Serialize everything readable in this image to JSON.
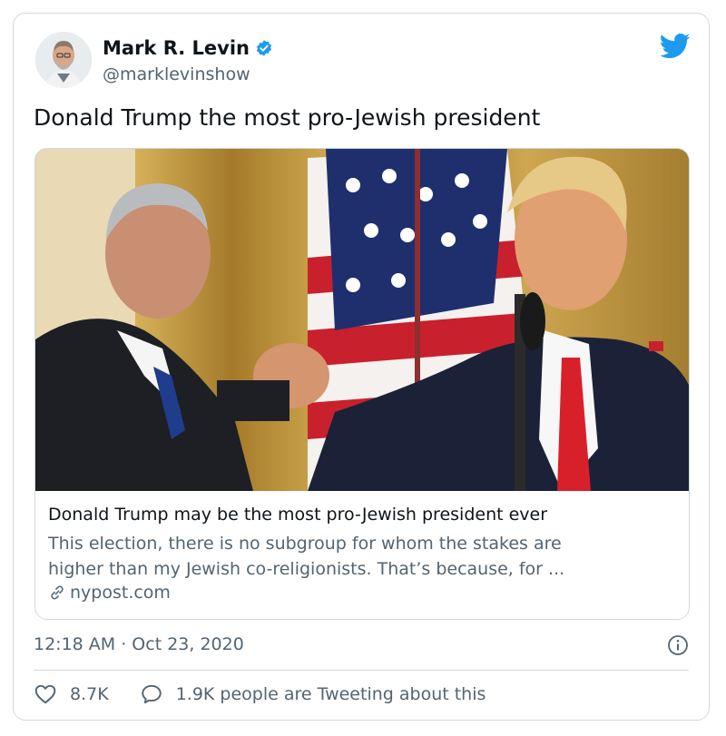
{
  "author": {
    "display_name": "Mark R. Levin",
    "handle": "@marklevinshow",
    "avatar_icon": "avatar-photo",
    "verified_icon": "verified-badge-icon"
  },
  "brand": {
    "icon": "twitter-bird-icon",
    "color": "#1d9bf0"
  },
  "tweet": {
    "text": "Donald Trump the most pro-Jewish president",
    "timestamp": "12:18 AM · Oct 23, 2020"
  },
  "link_card": {
    "image_icon": "news-photo",
    "title": "Donald Trump may be the most pro-Jewish president ever",
    "description_line1": "This election, there is no subgroup for whom the stakes are",
    "description_line2": "higher than my Jewish co-religionists. That’s because, for ...",
    "domain": "nypost.com",
    "domain_icon": "link-icon"
  },
  "actions": {
    "likes": "8.7K",
    "like_icon": "heart-icon",
    "replies_text": "1.9K people are Tweeting about this",
    "reply_icon": "speech-bubble-icon",
    "info_icon": "info-icon"
  },
  "colors": {
    "text_primary": "#0f1419",
    "text_secondary": "#536471",
    "border": "#cfd9de",
    "verified": "#1d9bf0"
  }
}
